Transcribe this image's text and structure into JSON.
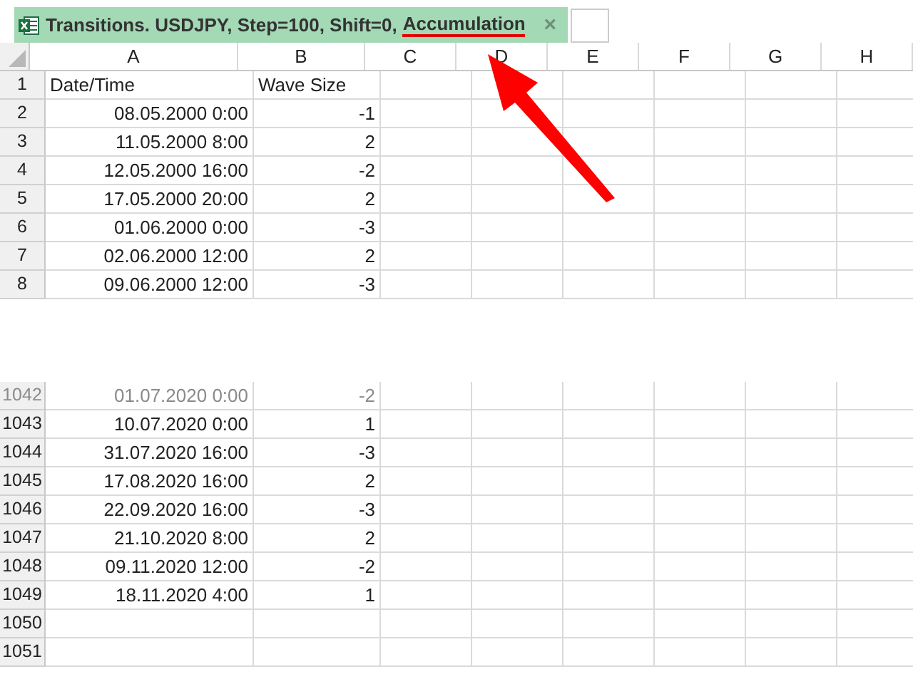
{
  "tab": {
    "title": "Transitions. USDJPY, Step=100, Shift=0,",
    "highlight": "Accumulation",
    "close": "×"
  },
  "columns": [
    "A",
    "B",
    "C",
    "D",
    "E",
    "F",
    "G",
    "H"
  ],
  "rows_top": [
    {
      "num": "1",
      "a": "Date/Time",
      "b": "Wave Size",
      "kind": "header"
    },
    {
      "num": "2",
      "a": "08.05.2000 0:00",
      "b": "-1",
      "kind": "data"
    },
    {
      "num": "3",
      "a": "11.05.2000 8:00",
      "b": "2",
      "kind": "data"
    },
    {
      "num": "4",
      "a": "12.05.2000 16:00",
      "b": "-2",
      "kind": "data"
    },
    {
      "num": "5",
      "a": "17.05.2000 20:00",
      "b": "2",
      "kind": "data"
    },
    {
      "num": "6",
      "a": "01.06.2000 0:00",
      "b": "-3",
      "kind": "data"
    },
    {
      "num": "7",
      "a": "02.06.2000 12:00",
      "b": "2",
      "kind": "data"
    },
    {
      "num": "8",
      "a": "09.06.2000 12:00",
      "b": "-3",
      "kind": "data"
    }
  ],
  "rows_bottom": [
    {
      "num": "1042",
      "a": "01.07.2020 0:00",
      "b": "-2",
      "kind": "faded"
    },
    {
      "num": "1043",
      "a": "10.07.2020 0:00",
      "b": "1",
      "kind": "data"
    },
    {
      "num": "1044",
      "a": "31.07.2020 16:00",
      "b": "-3",
      "kind": "data"
    },
    {
      "num": "1045",
      "a": "17.08.2020 16:00",
      "b": "2",
      "kind": "data"
    },
    {
      "num": "1046",
      "a": "22.09.2020 16:00",
      "b": "-3",
      "kind": "data"
    },
    {
      "num": "1047",
      "a": "21.10.2020 8:00",
      "b": "2",
      "kind": "data"
    },
    {
      "num": "1048",
      "a": "09.11.2020 12:00",
      "b": "-2",
      "kind": "data"
    },
    {
      "num": "1049",
      "a": "18.11.2020 4:00",
      "b": "1",
      "kind": "data"
    },
    {
      "num": "1050",
      "kind": "empty"
    },
    {
      "num": "1051",
      "kind": "empty"
    }
  ]
}
